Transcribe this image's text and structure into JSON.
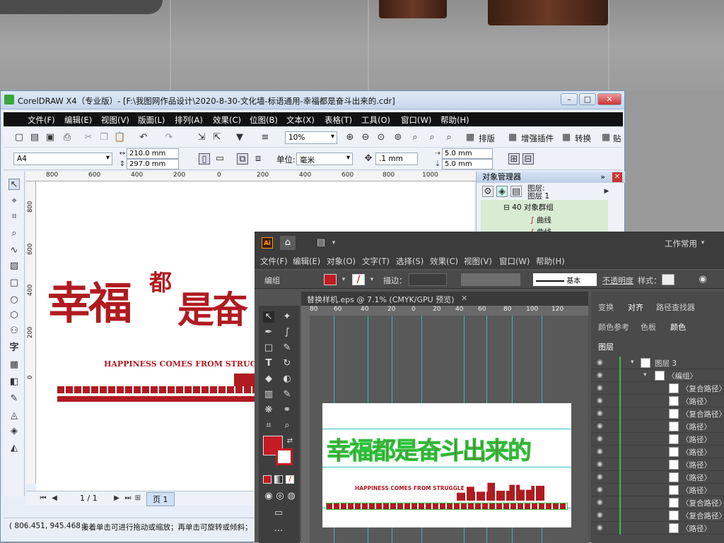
{
  "corel": {
    "title": "CorelDRAW X4（专业版）- [F:\\我图网作品设计\\2020-8-30-文化墙-标语通用-幸福都是奋斗出来的.cdr]",
    "menu": [
      "文件(F)",
      "编辑(E)",
      "视图(V)",
      "版面(L)",
      "排列(A)",
      "效果(C)",
      "位图(B)",
      "文本(X)",
      "表格(T)",
      "工具(O)",
      "窗口(W)",
      "帮助(H)"
    ],
    "zoom": "10%",
    "plugins": [
      "排版",
      "增强插件",
      "转换",
      "贴"
    ],
    "page_size": "A4",
    "width": "210.0 mm",
    "height": "297.0 mm",
    "unit_label": "单位:",
    "unit": "毫米",
    "nudge": ".1 mm",
    "dup_x": "5.0 mm",
    "dup_y": "5.0 mm",
    "ruler_h": [
      "800",
      "600",
      "400",
      "200",
      "0",
      "200",
      "400",
      "600",
      "800",
      "1000"
    ],
    "ruler_v": [
      "800",
      "600",
      "400",
      "200",
      "0"
    ],
    "artwork_main": "幸福",
    "artwork_main2": "都",
    "artwork_main3": "是奋",
    "artwork_sub": "HAPPINESS COMES FROM STRUG",
    "page_nav": "1 / 1",
    "page_tab": "页 1",
    "coords": "( 806.451, 945.468 )",
    "hint": "接着单击可进行拖动或缩放；再单击可旋转或倾斜；",
    "objmgr": {
      "title": "对象管理器",
      "layer_a": "图层:",
      "layer_b": "图层 1",
      "group": "40 对象群组",
      "curve1": "曲线",
      "curve2": "曲线"
    }
  },
  "ai": {
    "logo": "Ai",
    "workspace": "工作常用",
    "menu": [
      "文件(F)",
      "编辑(E)",
      "对象(O)",
      "文字(T)",
      "选择(S)",
      "效果(C)",
      "视图(V)",
      "窗口(W)",
      "帮助(H)"
    ],
    "ctrl_label": "编组",
    "stroke_label": "描边：",
    "brush": "基本",
    "opacity_label": "不透明度",
    "style_label": "样式：",
    "doc_tab": "替换样机.eps @ 7.1% (CMYK/GPU 预览)",
    "ruler_h": [
      "80",
      "60",
      "40",
      "20",
      "0",
      "20",
      "40",
      "60",
      "80",
      "100",
      "120"
    ],
    "artwork_main": "幸福都是奋斗出来的",
    "artwork_sub": "HAPPINESS COMES FROM STRUGGLE",
    "panel_tabs1": [
      "变换",
      "对齐",
      "路径查找器"
    ],
    "panel_tabs2": [
      "颜色参考",
      "色板",
      "颜色"
    ],
    "layers_tab": "图层",
    "layers": [
      "图层 3",
      "〈编组〉",
      "〈复合路径〉",
      "〈路径〉",
      "〈复合路径〉",
      "〈路径〉",
      "〈路径〉",
      "〈路径〉",
      "〈路径〉",
      "〈路径〉",
      "〈路径〉",
      "〈复合路径〉",
      "〈复合路径〉",
      "〈路径〉"
    ],
    "fill_color": "#c41a22"
  }
}
